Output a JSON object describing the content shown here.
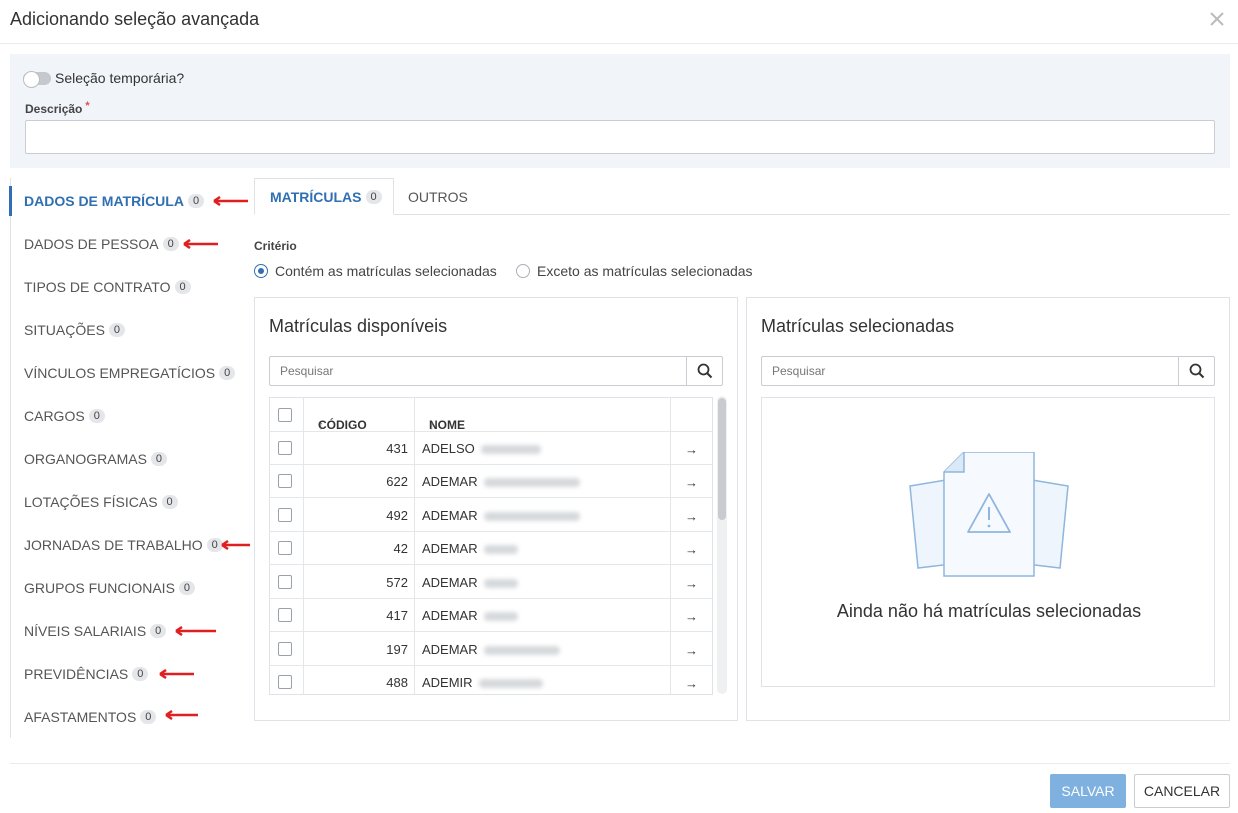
{
  "dialog": {
    "title": "Adicionando seleção avançada"
  },
  "form": {
    "temp_toggle_label": "Seleção temporária?",
    "description_label": "Descrição",
    "description_required": "*",
    "description_value": ""
  },
  "sidebar": {
    "items": [
      {
        "label": "DADOS DE MATRÍCULA",
        "count": "0",
        "active": true
      },
      {
        "label": "DADOS DE PESSOA",
        "count": "0"
      },
      {
        "label": "TIPOS DE CONTRATO",
        "count": "0"
      },
      {
        "label": "SITUAÇÕES",
        "count": "0"
      },
      {
        "label": "VÍNCULOS EMPREGATÍCIOS",
        "count": "0"
      },
      {
        "label": "CARGOS",
        "count": "0"
      },
      {
        "label": "ORGANOGRAMAS",
        "count": "0"
      },
      {
        "label": "LOTAÇÕES FÍSICAS",
        "count": "0"
      },
      {
        "label": "JORNADAS DE TRABALHO",
        "count": "0"
      },
      {
        "label": "GRUPOS FUNCIONAIS",
        "count": "0"
      },
      {
        "label": "NÍVEIS SALARIAIS",
        "count": "0"
      },
      {
        "label": "PREVIDÊNCIAS",
        "count": "0"
      },
      {
        "label": "AFASTAMENTOS",
        "count": "0"
      }
    ]
  },
  "tabs": [
    {
      "label": "MATRÍCULAS",
      "count": "0"
    },
    {
      "label": "OUTROS"
    }
  ],
  "criteria": {
    "label": "Critério",
    "option_contains": "Contém as matrículas selecionadas",
    "option_except": "Exceto as matrículas selecionadas",
    "selected": "contains"
  },
  "available": {
    "title": "Matrículas disponíveis",
    "search_placeholder": "Pesquisar",
    "col_code": "CÓDIGO",
    "col_name": "NOME",
    "rows": [
      {
        "code": "431",
        "name": "ADELSO"
      },
      {
        "code": "622",
        "name": "ADEMAR"
      },
      {
        "code": "492",
        "name": "ADEMAR"
      },
      {
        "code": "42",
        "name": "ADEMAR"
      },
      {
        "code": "572",
        "name": "ADEMAR"
      },
      {
        "code": "417",
        "name": "ADEMAR"
      },
      {
        "code": "197",
        "name": "ADEMAR"
      },
      {
        "code": "488",
        "name": "ADEMIR"
      }
    ]
  },
  "selected_panel": {
    "title": "Matrículas selecionadas",
    "search_placeholder": "Pesquisar",
    "empty_message": "Ainda não há matrículas selecionadas"
  },
  "actions": {
    "save": "SALVAR",
    "cancel": "CANCELAR"
  },
  "colors": {
    "accent": "#2f6fb2",
    "save_button": "#7fb1e0",
    "annotation_arrow": "#e02020"
  }
}
